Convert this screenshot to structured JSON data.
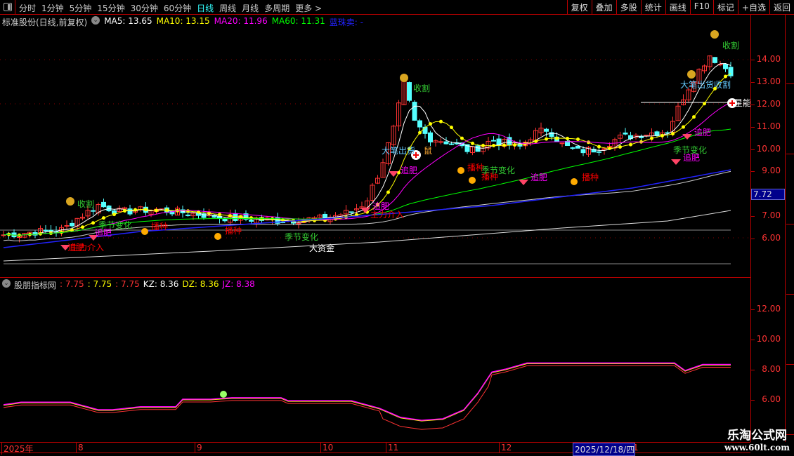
{
  "toolbar": {
    "periods": [
      "分时",
      "1分钟",
      "5分钟",
      "15分钟",
      "30分钟",
      "60分钟",
      "日线",
      "周线",
      "月线",
      "多周期",
      "更多 >"
    ],
    "active": "日线",
    "right_buttons": [
      "复权",
      "叠加",
      "多股",
      "统计",
      "画线",
      "F10",
      "标记",
      "+自选",
      "返回"
    ]
  },
  "main_legend": {
    "title": "标准股份(日线,前复权)",
    "ma5": "MA5: 13.65",
    "ma10": "MA10: 13.15",
    "ma20": "MA20: 11.96",
    "ma60": "MA60: 11.31",
    "blue": "蓝珠卖: -"
  },
  "colors": {
    "ma5": "#ffffff",
    "ma10": "#ffff00",
    "ma20": "#ff00ff",
    "ma60": "#00ff00",
    "up": "#ff3333",
    "down": "#54ffff",
    "axis": "#ff3333"
  },
  "price_axis": [
    "14.00",
    "13.00",
    "12.00",
    "11.00",
    "10.00",
    "9.00",
    "7.00",
    "6.00"
  ],
  "current_price": "7.72",
  "sub_legend": {
    "title": "股朋指标网",
    "v1": ": 7.75",
    "v2": ": 7.75",
    "v3": ": 7.75",
    "kz": "KZ: 8.36",
    "dz": "DZ: 8.36",
    "jz": "JZ: 8.38"
  },
  "sub_axis": [
    "12.00",
    "10.00",
    "8.00",
    "6.00"
  ],
  "dates": {
    "labels": [
      "2025年",
      "8",
      "9",
      "10",
      "11",
      "12",
      "1"
    ],
    "cursor": "2025/12/18/四"
  },
  "annotations": [
    "收割",
    "追肥",
    "季节变化",
    "追肥",
    "主力介入",
    "播种",
    "播种",
    "季节变化",
    "大资金",
    "收割",
    "大笔出货",
    "鼠",
    "追肥",
    "追肥",
    "主力介入",
    "播种",
    "播种",
    "季节变化",
    "追肥",
    "播种",
    "收割",
    "大笔出货收割",
    "星能",
    "追肥",
    "季节变化",
    "追肥"
  ],
  "watermark": {
    "name": "乐淘公式网",
    "url": "www.60lt.com"
  },
  "price_path": [
    [
      0,
      6.15
    ],
    [
      50,
      6.3
    ],
    [
      90,
      6.4
    ],
    [
      110,
      6.9
    ],
    [
      140,
      7.5
    ],
    [
      170,
      7.2
    ],
    [
      220,
      7.3
    ],
    [
      280,
      7.1
    ],
    [
      330,
      6.9
    ],
    [
      400,
      6.8
    ],
    [
      460,
      6.9
    ],
    [
      500,
      7.2
    ],
    [
      520,
      7.6
    ],
    [
      540,
      9.0
    ],
    [
      560,
      10.9
    ],
    [
      575,
      12.9
    ],
    [
      590,
      11.2
    ],
    [
      610,
      10.5
    ],
    [
      640,
      10.3
    ],
    [
      670,
      9.9
    ],
    [
      700,
      10.4
    ],
    [
      740,
      10.1
    ],
    [
      760,
      10.7
    ],
    [
      780,
      10.9
    ],
    [
      800,
      10.2
    ],
    [
      820,
      9.9
    ],
    [
      850,
      10.0
    ],
    [
      880,
      10.5
    ],
    [
      920,
      10.7
    ],
    [
      950,
      10.8
    ],
    [
      975,
      12.5
    ],
    [
      990,
      13.3
    ],
    [
      1010,
      14.2
    ],
    [
      1025,
      13.8
    ],
    [
      1042,
      13.4
    ]
  ],
  "indicator_path": [
    [
      0,
      5.6
    ],
    [
      30,
      5.8
    ],
    [
      100,
      5.8
    ],
    [
      140,
      5.3
    ],
    [
      160,
      5.3
    ],
    [
      200,
      5.5
    ],
    [
      250,
      5.5
    ],
    [
      260,
      6.0
    ],
    [
      300,
      6.0
    ],
    [
      330,
      6.1
    ],
    [
      400,
      6.1
    ],
    [
      410,
      5.9
    ],
    [
      500,
      5.9
    ],
    [
      540,
      5.4
    ],
    [
      570,
      4.8
    ],
    [
      600,
      4.6
    ],
    [
      630,
      4.7
    ],
    [
      660,
      5.3
    ],
    [
      680,
      6.4
    ],
    [
      700,
      7.8
    ],
    [
      720,
      8.0
    ],
    [
      750,
      8.4
    ],
    [
      960,
      8.4
    ],
    [
      975,
      7.9
    ],
    [
      1000,
      8.3
    ],
    [
      1040,
      8.3
    ]
  ]
}
